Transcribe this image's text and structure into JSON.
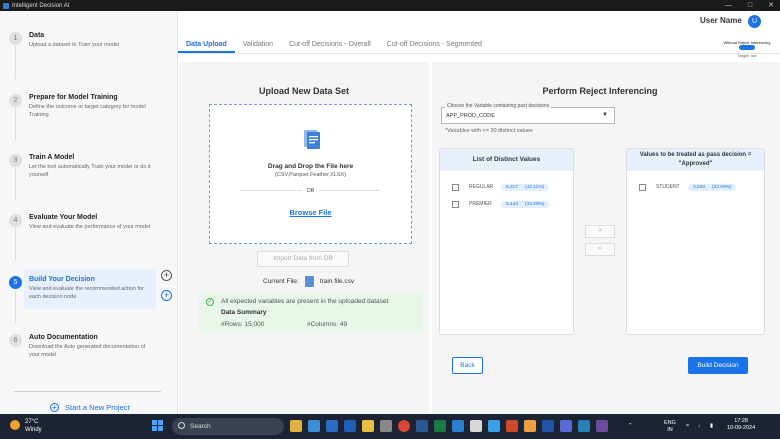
{
  "window": {
    "title": "Intelligent Decision AI"
  },
  "header": {
    "user_name": "User Name",
    "avatar_initial": "U"
  },
  "steps": [
    {
      "num": "1",
      "title": "Data",
      "desc": "Upload a dataset to Train your model"
    },
    {
      "num": "2",
      "title": "Prepare for Model Training",
      "desc": "Define the outcome or target category for model Training"
    },
    {
      "num": "3",
      "title": "Train A Model",
      "desc": "Let the tool automatically Train your model or do it yourself"
    },
    {
      "num": "4",
      "title": "Evaluate Your Model",
      "desc": "View and evaluate the performance of your model"
    },
    {
      "num": "5",
      "title": "Build Your Decision",
      "desc": "View and evaluate the recommended action for each decision node"
    },
    {
      "num": "6",
      "title": "Auto Documentation",
      "desc": "Download the Auto generated documentation of your model"
    }
  ],
  "sidebar": {
    "new_project": "Start a New Project"
  },
  "tabs": [
    {
      "label": "Data Upload"
    },
    {
      "label": "Validation"
    },
    {
      "label": "Cut-off Decisions - Overall"
    },
    {
      "label": "Cut-off Decisions - Segmented"
    }
  ],
  "reject_toggle": {
    "label": "Without Reject Inferencing",
    "target": "Target: out"
  },
  "upload": {
    "heading": "Upload New Data Set",
    "drag_text": "Drag and Drop the File here",
    "formats": "(CSV,Parquet,Feather,XLSX)",
    "or": "OR",
    "browse": "Browse File",
    "import_db": "Import Data from DB",
    "current_file_label": "Current File:",
    "current_file": "train file.csv"
  },
  "summary": {
    "message": "All expected variables are present in the uploaded dataset",
    "title": "Data Summary",
    "rows": "#Rows: 15,000",
    "columns": "#Columns: 49"
  },
  "reject": {
    "heading": "Perform Reject Inferencing",
    "select_label": "Choose the Variable containing past decisions",
    "select_value": "APP_PROD_CODE",
    "note": "*Variables with <= 20 distinct values",
    "list_title": "List of Distinct Values",
    "pass_title": "Values to be treated as pass decision = \"Approved\"",
    "distinct": [
      {
        "name": "REGULAR",
        "count": "6,317",
        "pct": "(42.11%)"
      },
      {
        "name": "PREMIER",
        "count": "5,144",
        "pct": "(34.29%)"
      }
    ],
    "pass_values": [
      {
        "name": "STUDENT",
        "count": "3,539",
        "pct": "(23.59%)"
      }
    ],
    "move_right": ">",
    "move_left": "<",
    "back": "Back",
    "build": "Build Decision"
  },
  "taskbar": {
    "temp": "27°C",
    "condition": "Windy",
    "search": "Search",
    "lang1": "ENG",
    "lang2": "IN",
    "time": "17:28",
    "date": "10-09-2024"
  }
}
